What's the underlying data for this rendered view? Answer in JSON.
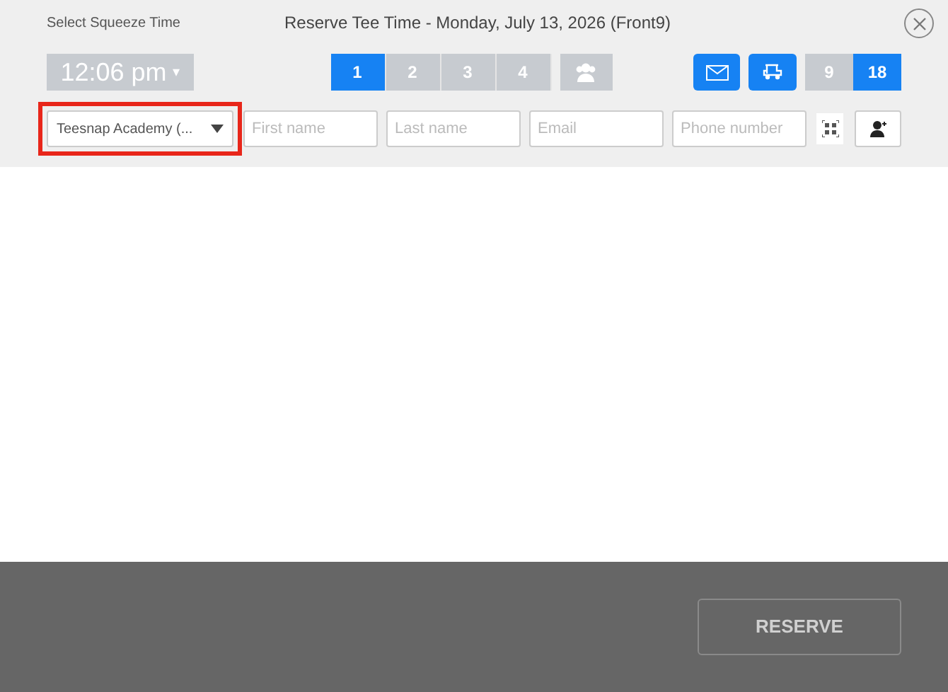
{
  "header": {
    "time_label": "Select Squeeze Time",
    "title": "Reserve Tee Time - Monday, July 13, 2026 (Front9)"
  },
  "time_select": {
    "value": "12:06 pm",
    "caret": "▾"
  },
  "players": [
    {
      "label": "1",
      "selected": true
    },
    {
      "label": "2",
      "selected": false
    },
    {
      "label": "3",
      "selected": false
    },
    {
      "label": "4",
      "selected": false
    }
  ],
  "group_button": {
    "selected": false
  },
  "email_toggle": {
    "on": true
  },
  "cart_toggle": {
    "on": true
  },
  "holes": [
    {
      "label": "9",
      "selected": false
    },
    {
      "label": "18",
      "selected": true
    }
  ],
  "customer": {
    "course_select": {
      "value": "Teesnap Academy (...",
      "highlighted": true
    },
    "fields": [
      {
        "placeholder": "First name"
      },
      {
        "placeholder": "Last name"
      },
      {
        "placeholder": "Email"
      },
      {
        "placeholder": "Phone number"
      }
    ]
  },
  "footer": {
    "button": "RESERVE"
  }
}
